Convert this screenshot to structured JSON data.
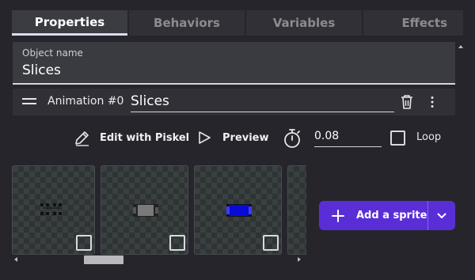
{
  "tabs": [
    {
      "label": "Properties",
      "active": true
    },
    {
      "label": "Behaviors",
      "active": false
    },
    {
      "label": "Variables",
      "active": false
    },
    {
      "label": "Effects",
      "active": false
    }
  ],
  "object_name": {
    "label": "Object name",
    "value": "Slices"
  },
  "animation": {
    "label": "Animation #0",
    "name": "Slices"
  },
  "tools": {
    "edit_label": "Edit with Piskel",
    "preview_label": "Preview",
    "timing": "0.08",
    "loop_label": "Loop",
    "loop_checked": false
  },
  "sprites": [
    {
      "kind": "dark-marks",
      "selected": false
    },
    {
      "kind": "gray-slice",
      "selected": false
    },
    {
      "kind": "blue-slice",
      "selected": false
    },
    {
      "kind": "partial",
      "selected": false
    }
  ],
  "add_sprite": {
    "label": "Add a sprite"
  },
  "colors": {
    "background": "#25252b",
    "accent": "#5a2ed6",
    "tab_active_underline": "#d9d9f2"
  },
  "icons": [
    "drag-handle-icon",
    "trash-icon",
    "more-vertical-icon",
    "pencil-icon",
    "play-icon",
    "timer-icon",
    "plus-icon",
    "chevron-down-icon"
  ]
}
